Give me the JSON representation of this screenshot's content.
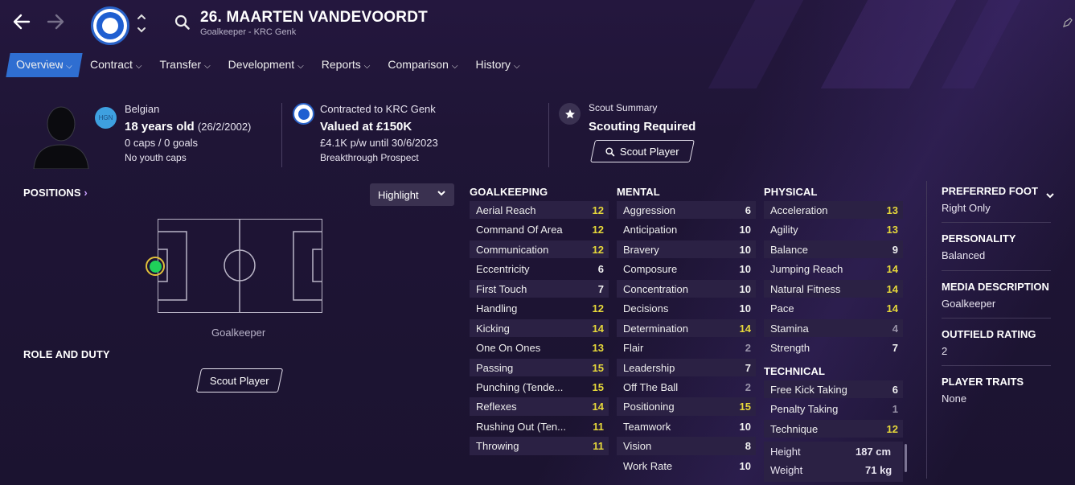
{
  "header": {
    "name": "26. MAARTEN VANDEVOORDT",
    "subtitle": "Goalkeeper - KRC Genk"
  },
  "tabs": [
    {
      "label": "Overview"
    },
    {
      "label": "Contract"
    },
    {
      "label": "Transfer"
    },
    {
      "label": "Development"
    },
    {
      "label": "Reports"
    },
    {
      "label": "Comparison"
    },
    {
      "label": "History"
    }
  ],
  "bio": {
    "nationality": "Belgian",
    "nation_code": "HGN",
    "age": "18 years old",
    "dob": "(26/2/2002)",
    "caps": "0 caps / 0 goals",
    "youth_caps": "No youth caps"
  },
  "contract": {
    "club": "Contracted to KRC Genk",
    "value": "Valued at £150K",
    "wage": "£4.1K p/w until 30/6/2023",
    "status": "Breakthrough Prospect"
  },
  "scout": {
    "label": "Scout Summary",
    "status": "Scouting Required",
    "button": "Scout Player"
  },
  "positions": {
    "heading": "POSITIONS",
    "position": "Goalkeeper",
    "highlight": "Highlight",
    "role_heading": "ROLE AND DUTY",
    "role_button": "Scout Player"
  },
  "goalkeeping": {
    "heading": "GOALKEEPING",
    "rows": [
      {
        "name": "Aerial Reach",
        "value": "12",
        "tone": "yel"
      },
      {
        "name": "Command Of Area",
        "value": "12",
        "tone": "yel"
      },
      {
        "name": "Communication",
        "value": "12",
        "tone": "yel"
      },
      {
        "name": "Eccentricity",
        "value": "6",
        "tone": "wht"
      },
      {
        "name": "First Touch",
        "value": "7",
        "tone": "wht"
      },
      {
        "name": "Handling",
        "value": "12",
        "tone": "yel"
      },
      {
        "name": "Kicking",
        "value": "14",
        "tone": "yel"
      },
      {
        "name": "One On Ones",
        "value": "13",
        "tone": "yel"
      },
      {
        "name": "Passing",
        "value": "15",
        "tone": "yel"
      },
      {
        "name": "Punching (Tende...",
        "value": "15",
        "tone": "yel"
      },
      {
        "name": "Reflexes",
        "value": "14",
        "tone": "yel"
      },
      {
        "name": "Rushing Out (Ten...",
        "value": "11",
        "tone": "yel"
      },
      {
        "name": "Throwing",
        "value": "11",
        "tone": "yel"
      }
    ]
  },
  "mental": {
    "heading": "MENTAL",
    "rows": [
      {
        "name": "Aggression",
        "value": "6",
        "tone": "wht"
      },
      {
        "name": "Anticipation",
        "value": "10",
        "tone": "wht"
      },
      {
        "name": "Bravery",
        "value": "10",
        "tone": "wht"
      },
      {
        "name": "Composure",
        "value": "10",
        "tone": "wht"
      },
      {
        "name": "Concentration",
        "value": "10",
        "tone": "wht"
      },
      {
        "name": "Decisions",
        "value": "10",
        "tone": "wht"
      },
      {
        "name": "Determination",
        "value": "14",
        "tone": "yel"
      },
      {
        "name": "Flair",
        "value": "2",
        "tone": "gry"
      },
      {
        "name": "Leadership",
        "value": "7",
        "tone": "wht"
      },
      {
        "name": "Off The Ball",
        "value": "2",
        "tone": "gry"
      },
      {
        "name": "Positioning",
        "value": "15",
        "tone": "yel"
      },
      {
        "name": "Teamwork",
        "value": "10",
        "tone": "wht"
      },
      {
        "name": "Vision",
        "value": "8",
        "tone": "wht"
      },
      {
        "name": "Work Rate",
        "value": "10",
        "tone": "wht"
      }
    ]
  },
  "physical": {
    "heading": "PHYSICAL",
    "rows": [
      {
        "name": "Acceleration",
        "value": "13",
        "tone": "yel"
      },
      {
        "name": "Agility",
        "value": "13",
        "tone": "yel"
      },
      {
        "name": "Balance",
        "value": "9",
        "tone": "wht"
      },
      {
        "name": "Jumping Reach",
        "value": "14",
        "tone": "yel"
      },
      {
        "name": "Natural Fitness",
        "value": "14",
        "tone": "yel"
      },
      {
        "name": "Pace",
        "value": "14",
        "tone": "yel"
      },
      {
        "name": "Stamina",
        "value": "4",
        "tone": "gry"
      },
      {
        "name": "Strength",
        "value": "7",
        "tone": "wht"
      }
    ]
  },
  "technical": {
    "heading": "TECHNICAL",
    "rows": [
      {
        "name": "Free Kick Taking",
        "value": "6",
        "tone": "wht"
      },
      {
        "name": "Penalty Taking",
        "value": "1",
        "tone": "gry"
      },
      {
        "name": "Technique",
        "value": "12",
        "tone": "yel"
      }
    ]
  },
  "measures": {
    "height_label": "Height",
    "height_value": "187 cm",
    "weight_label": "Weight",
    "weight_value": "71 kg"
  },
  "side": {
    "foot_h": "PREFERRED FOOT",
    "foot_v": "Right Only",
    "personality_h": "PERSONALITY",
    "personality_v": "Balanced",
    "media_h": "MEDIA DESCRIPTION",
    "media_v": "Goalkeeper",
    "outfield_h": "OUTFIELD RATING",
    "outfield_v": "2",
    "traits_h": "PLAYER TRAITS",
    "traits_v": "None"
  },
  "colors": {
    "accent": "#2f6ed1",
    "highlight_value": "#e6d83a",
    "low_value": "#9a94aa",
    "position_dot": "#1fd15a"
  }
}
